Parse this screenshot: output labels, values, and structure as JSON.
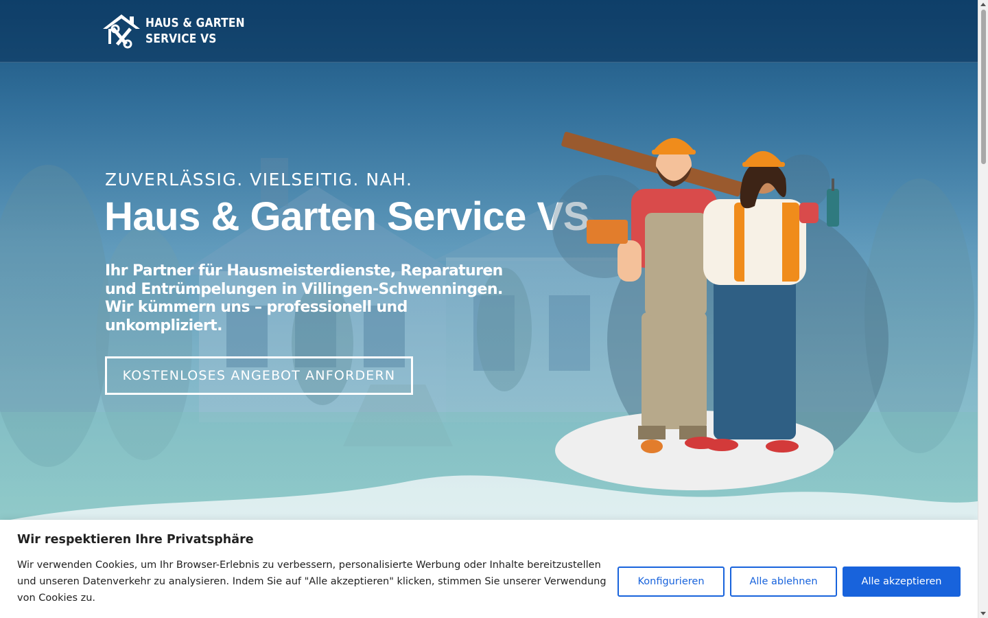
{
  "brand": {
    "line1": "HAUS & GARTEN",
    "line2": "SERVICE VS",
    "logo_icon": "house-tools-icon"
  },
  "hero": {
    "tagline": "ZUVERLÄSSIG. VIELSEITIG. NAH.",
    "title": "Haus & Garten Service VS",
    "description": "Ihr Partner für Hausmeisterdienste, Reparaturen und Entrümpelungen in Villingen-Schwenningen. Wir kümmern uns – professionell und unkompliziert.",
    "cta_label": "KOSTENLOSES ANGEBOT ANFORDERN"
  },
  "cookie": {
    "title": "Wir respektieren Ihre Privatsphäre",
    "text": "Wir verwenden Cookies, um Ihr Browser-Erlebnis zu verbessern, personalisierte Werbung oder Inhalte bereitzustellen und unseren Datenverkehr zu analysieren. Indem Sie auf \"Alle akzeptieren\" klicken, stimmen Sie unserer Verwendung von Cookies zu.",
    "configure_label": "Konfigurieren",
    "reject_label": "Alle ablehnen",
    "accept_label": "Alle akzeptieren"
  },
  "colors": {
    "accent": "#1863dc",
    "header_bg": "#0b3a66",
    "hero_overlay": "#4f8fb8",
    "text_dark": "#212121"
  }
}
